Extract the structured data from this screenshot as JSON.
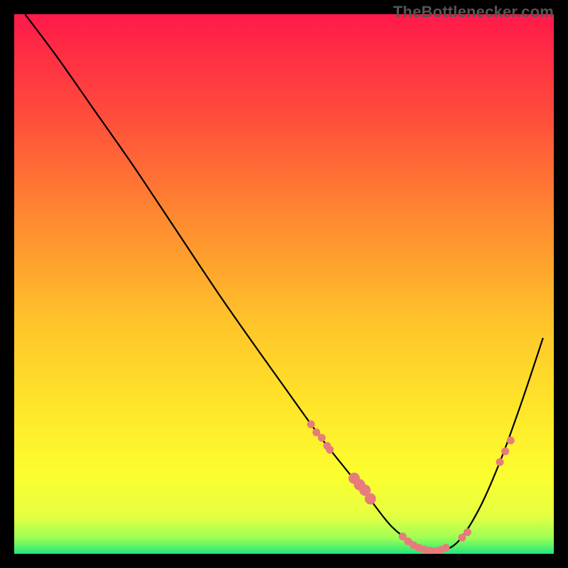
{
  "watermark": "TheBottlenecker.com",
  "chart_data": {
    "type": "line",
    "title": "",
    "xlabel": "",
    "ylabel": "",
    "xlim": [
      0,
      100
    ],
    "ylim": [
      0,
      100
    ],
    "background_gradient": [
      "#ff1a4a",
      "#ff6a36",
      "#ffb52e",
      "#ffe22a",
      "#fff82e",
      "#dfff48",
      "#2aff7a"
    ],
    "series": [
      {
        "name": "bottleneck-curve",
        "type": "line",
        "x": [
          2,
          8,
          15,
          22,
          30,
          38,
          45,
          50,
          55,
          58,
          62,
          66,
          70,
          74,
          78,
          82,
          86,
          90,
          94,
          98
        ],
        "y": [
          100,
          92,
          82,
          72,
          60,
          48,
          38,
          31,
          24,
          20,
          15,
          10,
          5,
          2,
          0.5,
          2,
          8,
          17,
          28,
          40
        ]
      },
      {
        "name": "markers",
        "type": "scatter",
        "x": [
          55,
          56,
          57,
          58,
          58.5,
          63,
          64,
          65,
          66,
          72,
          73,
          74,
          75,
          76,
          77,
          78,
          79,
          80,
          83,
          84,
          90,
          91,
          92
        ],
        "y": [
          24,
          22.5,
          21.5,
          20,
          19.3,
          14,
          12.8,
          11.8,
          10.2,
          3.2,
          2.3,
          1.6,
          1.1,
          0.8,
          0.6,
          0.5,
          0.7,
          1.1,
          3,
          4,
          17,
          19,
          21
        ],
        "color": "#e67c7c",
        "size_pattern": [
          "small",
          "small",
          "small",
          "small",
          "small",
          "big",
          "big",
          "big",
          "big",
          "small",
          "small",
          "small",
          "small",
          "small",
          "small",
          "small",
          "small",
          "small",
          "small",
          "small",
          "small",
          "small",
          "small"
        ]
      }
    ]
  }
}
